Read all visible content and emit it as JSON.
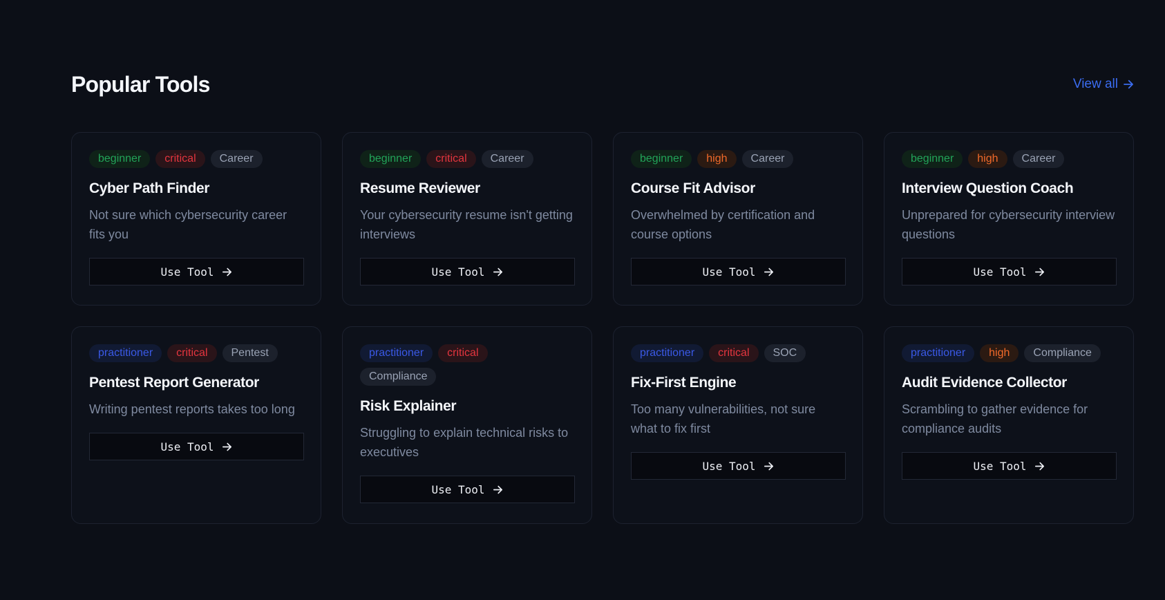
{
  "header": {
    "title": "Popular Tools",
    "view_all_label": "View all"
  },
  "colors": {
    "background": "#0c0f17",
    "card_bg": "#0d111a",
    "accent": "#3b6cf0",
    "beginner": "#22a559",
    "practitioner": "#3a59e6",
    "critical": "#e5353f",
    "high": "#f26a2a"
  },
  "cards": [
    {
      "tags": [
        {
          "label": "beginner",
          "kind": "beginner"
        },
        {
          "label": "critical",
          "kind": "critical"
        },
        {
          "label": "Career",
          "kind": "cat"
        }
      ],
      "title": "Cyber Path Finder",
      "description": "Not sure which cybersecurity career fits you",
      "button": "Use Tool",
      "button_icon": "arrow-right-icon"
    },
    {
      "tags": [
        {
          "label": "beginner",
          "kind": "beginner"
        },
        {
          "label": "critical",
          "kind": "critical"
        },
        {
          "label": "Career",
          "kind": "cat"
        }
      ],
      "title": "Resume Reviewer",
      "description": "Your cybersecurity resume isn't getting interviews",
      "button": "Use Tool",
      "button_icon": "arrow-right-icon"
    },
    {
      "tags": [
        {
          "label": "beginner",
          "kind": "beginner"
        },
        {
          "label": "high",
          "kind": "high"
        },
        {
          "label": "Career",
          "kind": "cat"
        }
      ],
      "title": "Course Fit Advisor",
      "description": "Overwhelmed by certification and course options",
      "button": "Use Tool",
      "button_icon": "arrow-right-icon"
    },
    {
      "tags": [
        {
          "label": "beginner",
          "kind": "beginner"
        },
        {
          "label": "high",
          "kind": "high"
        },
        {
          "label": "Career",
          "kind": "cat"
        }
      ],
      "title": "Interview Question Coach",
      "description": "Unprepared for cybersecurity interview questions",
      "button": "Use Tool",
      "button_icon": "arrow-right-icon"
    },
    {
      "tags": [
        {
          "label": "practitioner",
          "kind": "practitioner"
        },
        {
          "label": "critical",
          "kind": "critical"
        },
        {
          "label": "Pentest",
          "kind": "cat"
        }
      ],
      "title": "Pentest Report Generator",
      "description": "Writing pentest reports takes too long",
      "button": "Use Tool",
      "button_icon": "arrow-right-icon"
    },
    {
      "tags": [
        {
          "label": "practitioner",
          "kind": "practitioner"
        },
        {
          "label": "critical",
          "kind": "critical"
        },
        {
          "label": "Compliance",
          "kind": "cat"
        }
      ],
      "title": "Risk Explainer",
      "description": "Struggling to explain technical risks to executives",
      "button": "Use Tool",
      "button_icon": "arrow-right-icon"
    },
    {
      "tags": [
        {
          "label": "practitioner",
          "kind": "practitioner"
        },
        {
          "label": "critical",
          "kind": "critical"
        },
        {
          "label": "SOC",
          "kind": "cat"
        }
      ],
      "title": "Fix-First Engine",
      "description": "Too many vulnerabilities, not sure what to fix first",
      "button": "Use Tool",
      "button_icon": "arrow-right-icon"
    },
    {
      "tags": [
        {
          "label": "practitioner",
          "kind": "practitioner"
        },
        {
          "label": "high",
          "kind": "high"
        },
        {
          "label": "Compliance",
          "kind": "cat"
        }
      ],
      "title": "Audit Evidence Collector",
      "description": "Scrambling to gather evidence for compliance audits",
      "button": "Use Tool",
      "button_icon": "arrow-right-icon"
    }
  ]
}
